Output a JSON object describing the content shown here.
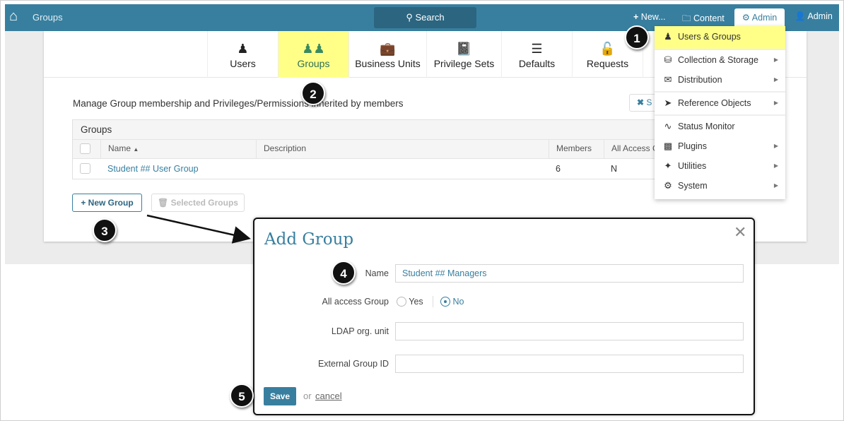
{
  "nav": {
    "title": "Groups",
    "search": "Search",
    "new": "New...",
    "content": "Content",
    "admin": "Admin",
    "user": "Admin"
  },
  "tabs": [
    {
      "label": "Users"
    },
    {
      "label": "Groups"
    },
    {
      "label": "Business Units"
    },
    {
      "label": "Privilege Sets"
    },
    {
      "label": "Defaults"
    },
    {
      "label": "Requests"
    }
  ],
  "menu": [
    {
      "label": "Users & Groups"
    },
    {
      "label": "Collection & Storage"
    },
    {
      "label": "Distribution"
    },
    {
      "label": "Reference Objects"
    },
    {
      "label": "Status Monitor"
    },
    {
      "label": "Plugins"
    },
    {
      "label": "Utilities"
    },
    {
      "label": "System"
    }
  ],
  "main": {
    "description": "Manage Group membership and Privileges/Permissions inherited by members",
    "partial_button": "S",
    "table": {
      "title": "Groups",
      "columns": [
        "Name",
        "Description",
        "Members",
        "All Access G"
      ],
      "rows": [
        {
          "name": "Student ## User Group",
          "description": "",
          "members": "6",
          "all_access": "N"
        }
      ]
    },
    "new_group": "New Group",
    "selected_groups": "Selected Groups"
  },
  "modal": {
    "title": "Add Group",
    "name_label": "Name",
    "name_value": "Student ## Managers",
    "all_access_label": "All access Group",
    "yes": "Yes",
    "no": "No",
    "selected": "No",
    "ldap_label": "LDAP org. unit",
    "ext_label": "External Group ID",
    "save": "Save",
    "or": "or",
    "cancel": "cancel"
  },
  "badges": [
    "1",
    "2",
    "3",
    "4",
    "5"
  ],
  "colors": {
    "nav": "#387f9f",
    "highlight": "#ffff88",
    "link": "#387f9f"
  }
}
